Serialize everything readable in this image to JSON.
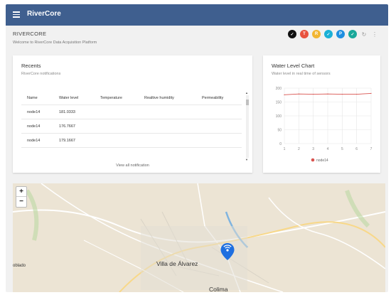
{
  "app": {
    "title": "RiverCore"
  },
  "page": {
    "title": "RIVERCORE",
    "subtitle": "Welcome to RiverCore Data Acquisition Platform"
  },
  "toolbar": {
    "dots": [
      {
        "label": "✓",
        "color": "#111111"
      },
      {
        "label": "T",
        "color": "#e8533f"
      },
      {
        "label": "R",
        "color": "#f2b632"
      },
      {
        "label": "✓",
        "color": "#1bb0d6"
      },
      {
        "label": "P",
        "color": "#1f8fe0"
      },
      {
        "label": "✓",
        "color": "#1aa89a"
      }
    ],
    "refresh_icon": "↻",
    "more_icon": "⋮"
  },
  "recents": {
    "title": "Recents",
    "subtitle": "RiverCore notifications",
    "columns": [
      "Name",
      "Water level",
      "Temperature",
      "Realtive humidity",
      "Permeability"
    ],
    "rows": [
      {
        "name": "node14",
        "water": "181.0333",
        "temp": "",
        "hum": "",
        "perm": ""
      },
      {
        "name": "node14",
        "water": "176.7667",
        "temp": "",
        "hum": "",
        "perm": ""
      },
      {
        "name": "node14",
        "water": "179.1667",
        "temp": "",
        "hum": "",
        "perm": ""
      }
    ],
    "view_all": "View all notification"
  },
  "water_chart": {
    "title": "Water Level Chart",
    "subtitle": "Water level in real time of sensors",
    "legend_label": "node14"
  },
  "chart_data": {
    "type": "line",
    "x": [
      1,
      2,
      3,
      4,
      5,
      6,
      7
    ],
    "series": [
      {
        "name": "node14",
        "values": [
          176,
          179,
          178,
          179,
          178,
          178,
          181
        ],
        "color": "#d9534f"
      }
    ],
    "yticks": [
      0,
      50,
      100,
      150,
      200
    ],
    "ylim": [
      0,
      200
    ],
    "xlim": [
      1,
      7
    ],
    "grid": true,
    "legend": "bottom"
  },
  "map": {
    "labels": {
      "city1": "Villa de Álvarez",
      "city2": "Colima",
      "city3": "oblado"
    },
    "zoom_in": "+",
    "zoom_out": "−"
  }
}
